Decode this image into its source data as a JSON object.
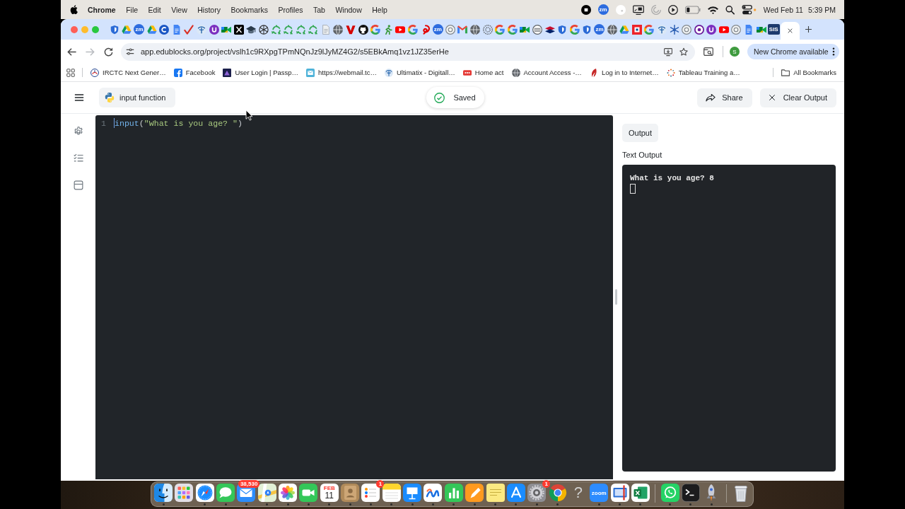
{
  "menu_bar": {
    "app_name": "Chrome",
    "menus": [
      "File",
      "Edit",
      "View",
      "History",
      "Bookmarks",
      "Profiles",
      "Tab",
      "Window",
      "Help"
    ],
    "status_items": [
      {
        "kind": "stop-record"
      },
      {
        "kind": "text-badge",
        "text": "zm"
      },
      {
        "kind": "white-dot"
      },
      {
        "kind": "display"
      },
      {
        "kind": "spinner"
      },
      {
        "kind": "play"
      },
      {
        "kind": "battery"
      },
      {
        "kind": "wifi"
      },
      {
        "kind": "search"
      },
      {
        "kind": "control-center"
      }
    ],
    "date": "Wed Feb 11",
    "time": "5:39 PM"
  },
  "browser": {
    "tabs": [
      {
        "kind": "shield",
        "selected": false
      },
      {
        "kind": "drive",
        "selected": false
      },
      {
        "kind": "text-badge",
        "text": "zm",
        "selected": false
      },
      {
        "kind": "drive",
        "selected": false
      },
      {
        "kind": "c-logo",
        "selected": false
      },
      {
        "kind": "doc",
        "selected": false
      },
      {
        "kind": "check",
        "selected": false
      },
      {
        "kind": "emblem",
        "selected": false
      },
      {
        "kind": "u-logo",
        "selected": false
      },
      {
        "kind": "meet",
        "selected": false
      },
      {
        "kind": "x-logo",
        "selected": false
      },
      {
        "kind": "cap",
        "selected": false
      },
      {
        "kind": "knot",
        "selected": false
      },
      {
        "kind": "recycle",
        "selected": false
      },
      {
        "kind": "recycle",
        "selected": false
      },
      {
        "kind": "recycle",
        "selected": false
      },
      {
        "kind": "recycle",
        "selected": false
      },
      {
        "kind": "file",
        "selected": false
      },
      {
        "kind": "globe",
        "selected": false
      },
      {
        "kind": "chevron",
        "selected": false
      },
      {
        "kind": "github",
        "selected": false
      },
      {
        "kind": "google",
        "selected": false
      },
      {
        "kind": "figure",
        "selected": false
      },
      {
        "kind": "play",
        "selected": false
      },
      {
        "kind": "google",
        "selected": false
      },
      {
        "kind": "swirl",
        "selected": false
      },
      {
        "kind": "text-badge",
        "text": "zm",
        "selected": false
      },
      {
        "kind": "ring",
        "selected": false
      },
      {
        "kind": "mail",
        "selected": false
      },
      {
        "kind": "globe",
        "selected": false
      },
      {
        "kind": "dotted",
        "selected": false
      },
      {
        "kind": "google",
        "selected": false
      },
      {
        "kind": "google",
        "selected": false
      },
      {
        "kind": "meet",
        "selected": false
      },
      {
        "kind": "striped",
        "selected": false
      },
      {
        "kind": "flag",
        "selected": false
      },
      {
        "kind": "shield",
        "selected": false
      },
      {
        "kind": "google",
        "selected": false
      },
      {
        "kind": "shield",
        "selected": false
      },
      {
        "kind": "text-badge",
        "text": "zm",
        "selected": false
      },
      {
        "kind": "globe",
        "selected": false
      },
      {
        "kind": "drive",
        "selected": false
      },
      {
        "kind": "square-logo",
        "selected": false
      },
      {
        "kind": "google",
        "selected": false
      },
      {
        "kind": "emblem",
        "selected": false
      },
      {
        "kind": "snowflake",
        "selected": false
      },
      {
        "kind": "ring",
        "selected": false
      },
      {
        "kind": "ring-logo",
        "selected": false
      },
      {
        "kind": "u-logo",
        "selected": false
      },
      {
        "kind": "play",
        "selected": false
      },
      {
        "kind": "ring",
        "selected": false
      },
      {
        "kind": "doc",
        "selected": false
      },
      {
        "kind": "meet",
        "selected": false
      },
      {
        "kind": "text-square",
        "text": "SIS",
        "selected": false
      },
      {
        "selected": true
      }
    ],
    "toolbar": {
      "nav": [
        {
          "kind": "back",
          "disabled": false
        },
        {
          "kind": "forward",
          "disabled": true
        },
        {
          "kind": "reload",
          "disabled": false
        }
      ],
      "url": "app.edublocks.org/project/vslh1c9RXpgTPmNQnJz9lJyMZ4G2/s5EBkAmq1vz1JZ35erHe",
      "profile_initial": "S",
      "update_button": "New Chrome available"
    },
    "bookmarks": [
      {
        "kind": "irctc",
        "label": "IRCTC Next Gener…"
      },
      {
        "kind": "facebook",
        "label": "Facebook"
      },
      {
        "kind": "dark-tile",
        "label": "User Login | Passp…"
      },
      {
        "kind": "mail-tile",
        "label": "https://webmail.tc…"
      },
      {
        "kind": "emblem",
        "label": "Ultimatix - Digitall…"
      },
      {
        "kind": "red-tile",
        "label": "Home act"
      },
      {
        "kind": "globe",
        "label": "Account Access -…"
      },
      {
        "kind": "leaf",
        "label": "Log in to Internet…"
      },
      {
        "kind": "plus-cluster",
        "label": "Tableau Training a…"
      }
    ],
    "all_bookmarks": "All Bookmarks"
  },
  "app": {
    "project_button": "input function",
    "save_status": "Saved",
    "actions": [
      {
        "kind": "share",
        "label": "Share"
      },
      {
        "kind": "clear",
        "label": "Clear Output"
      }
    ],
    "sidebar": [
      {
        "kind": "settings"
      },
      {
        "kind": "checklist"
      },
      {
        "kind": "package"
      }
    ],
    "editor": {
      "lines": [
        {
          "number": "1",
          "tokens": [
            {
              "kind": "function",
              "text": "input"
            },
            {
              "kind": "punctuation",
              "text": "("
            },
            {
              "kind": "string",
              "text": "\"What is you age? \""
            },
            {
              "kind": "punctuation",
              "text": ")"
            }
          ]
        }
      ]
    },
    "output": {
      "tab": "Output",
      "section_title": "Text Output",
      "console_lines": [
        "What is you age? 8"
      ]
    }
  },
  "dock": {
    "items": [
      {
        "kind": "finder",
        "running": true
      },
      {
        "kind": "launchpad",
        "running": false
      },
      {
        "kind": "safari",
        "running": true
      },
      {
        "kind": "messages",
        "running": true
      },
      {
        "kind": "mail",
        "badge": "38,530",
        "running": true
      },
      {
        "kind": "maps",
        "running": true
      },
      {
        "kind": "photos",
        "running": true
      },
      {
        "kind": "facetime",
        "running": true
      },
      {
        "kind": "calendar",
        "month": "FEB",
        "day": "11",
        "running": true
      },
      {
        "kind": "contacts",
        "running": true
      },
      {
        "kind": "reminders",
        "badge": "1",
        "running": true
      },
      {
        "kind": "notes",
        "running": true
      },
      {
        "kind": "keynote",
        "running": true
      },
      {
        "kind": "freeform",
        "running": true
      },
      {
        "kind": "numbers",
        "running": true
      },
      {
        "kind": "pages",
        "running": true
      },
      {
        "kind": "stickies",
        "running": true
      },
      {
        "kind": "appstore",
        "running": true
      },
      {
        "kind": "settings",
        "badge": "1",
        "running": true
      },
      {
        "kind": "chrome",
        "running": true
      },
      {
        "kind": "unknown",
        "text": "?",
        "running": false
      },
      {
        "kind": "zoom",
        "text": "zoom",
        "running": true
      },
      {
        "kind": "window-tile",
        "running": true
      },
      {
        "kind": "excel",
        "running": true
      },
      {
        "kind": "separator"
      },
      {
        "kind": "whatsapp",
        "running": true
      },
      {
        "kind": "terminal",
        "running": true
      },
      {
        "kind": "rocket",
        "running": true
      },
      {
        "kind": "separator"
      },
      {
        "kind": "trash",
        "running": false
      }
    ]
  }
}
